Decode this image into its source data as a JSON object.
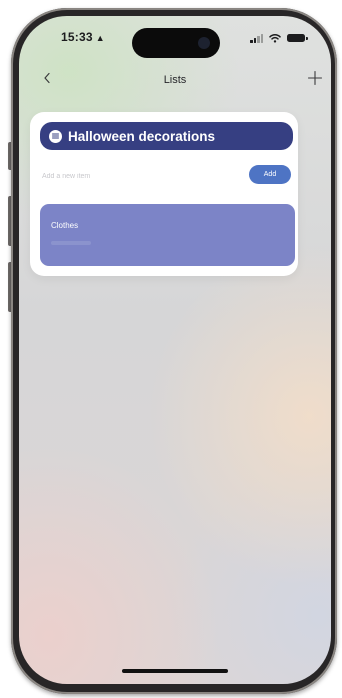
{
  "status_bar": {
    "time": "15:33",
    "alarm_icon": "alarm-clock-icon",
    "signal_icon": "cellular-signal-icon",
    "wifi_icon": "wifi-icon",
    "battery_icon": "battery-icon"
  },
  "nav": {
    "back_icon": "chevron-left-icon",
    "title": "Lists",
    "add_icon": "plus-icon"
  },
  "list": {
    "icon": "list-icon",
    "title": "Halloween decorations",
    "new_item_placeholder": "Add a new item",
    "add_button_label": "Add",
    "items": [
      {
        "label": "Clothes"
      }
    ]
  },
  "colors": {
    "list_header": "#363f82",
    "add_button": "#4e74c4",
    "item_card": "#7c84c7",
    "card_background": "#ffffff"
  }
}
